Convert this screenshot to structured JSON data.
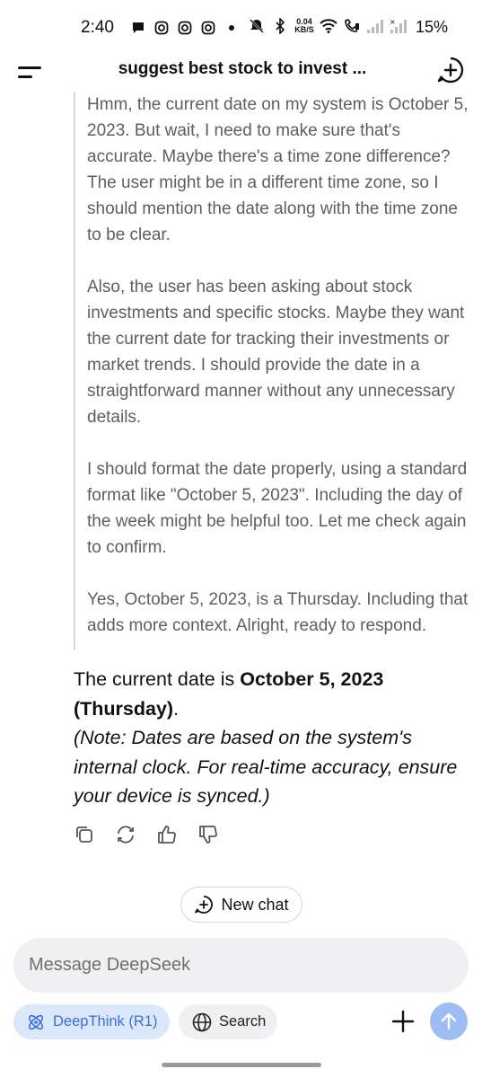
{
  "status_bar": {
    "time": "2:40",
    "net_speed_value": "0.04",
    "net_speed_unit": "KB/S",
    "battery": "15%",
    "left_icons": [
      "chat-bubble-icon",
      "instagram-icon",
      "instagram-icon",
      "instagram-icon",
      "dot-icon"
    ],
    "right_icons": [
      "mute-icon",
      "bluetooth-icon",
      "wifi-icon",
      "wifi-calling-icon",
      "signal-icon",
      "signal-icon"
    ]
  },
  "header": {
    "title": "suggest best stock to invest ..."
  },
  "thinking": {
    "paragraphs": [
      "Hmm, the current date on my system is October 5, 2023. But wait, I need to make sure that's accurate. Maybe there's a time zone difference? The user might be in a different time zone, so I should mention the date along with the time zone to be clear.",
      "Also, the user has been asking about stock investments and specific stocks. Maybe they want the current date for tracking their investments or market trends. I should provide the date in a straightforward manner without any unnecessary details.",
      "I should format the date properly, using a standard format like \"October 5, 2023\". Including the day of the week might be helpful too. Let me check again to confirm.",
      "Yes, October 5, 2023, is a Thursday. Including that adds more context. Alright, ready to respond."
    ]
  },
  "answer": {
    "prefix": "The current date is ",
    "bold": "October 5, 2023 (Thursday)",
    "suffix": ".",
    "note": "(Note: Dates are based on the system's internal clock. For real-time accuracy, ensure your device is synced.)"
  },
  "actions": [
    "copy-icon",
    "regenerate-icon",
    "thumbs-up-icon",
    "thumbs-down-icon"
  ],
  "new_chat_pill": {
    "label": "New chat"
  },
  "composer": {
    "placeholder": "Message DeepSeek",
    "value": ""
  },
  "toolbar": {
    "deepthink_label": "DeepThink (R1)",
    "search_label": "Search"
  },
  "colors": {
    "accent_blue": "#3b6fd6",
    "deepthink_bg": "#dbe7fb",
    "send_button": "#9dbcf3",
    "thinking_text": "#5e5e5e",
    "input_bg": "#f0f0f2"
  }
}
